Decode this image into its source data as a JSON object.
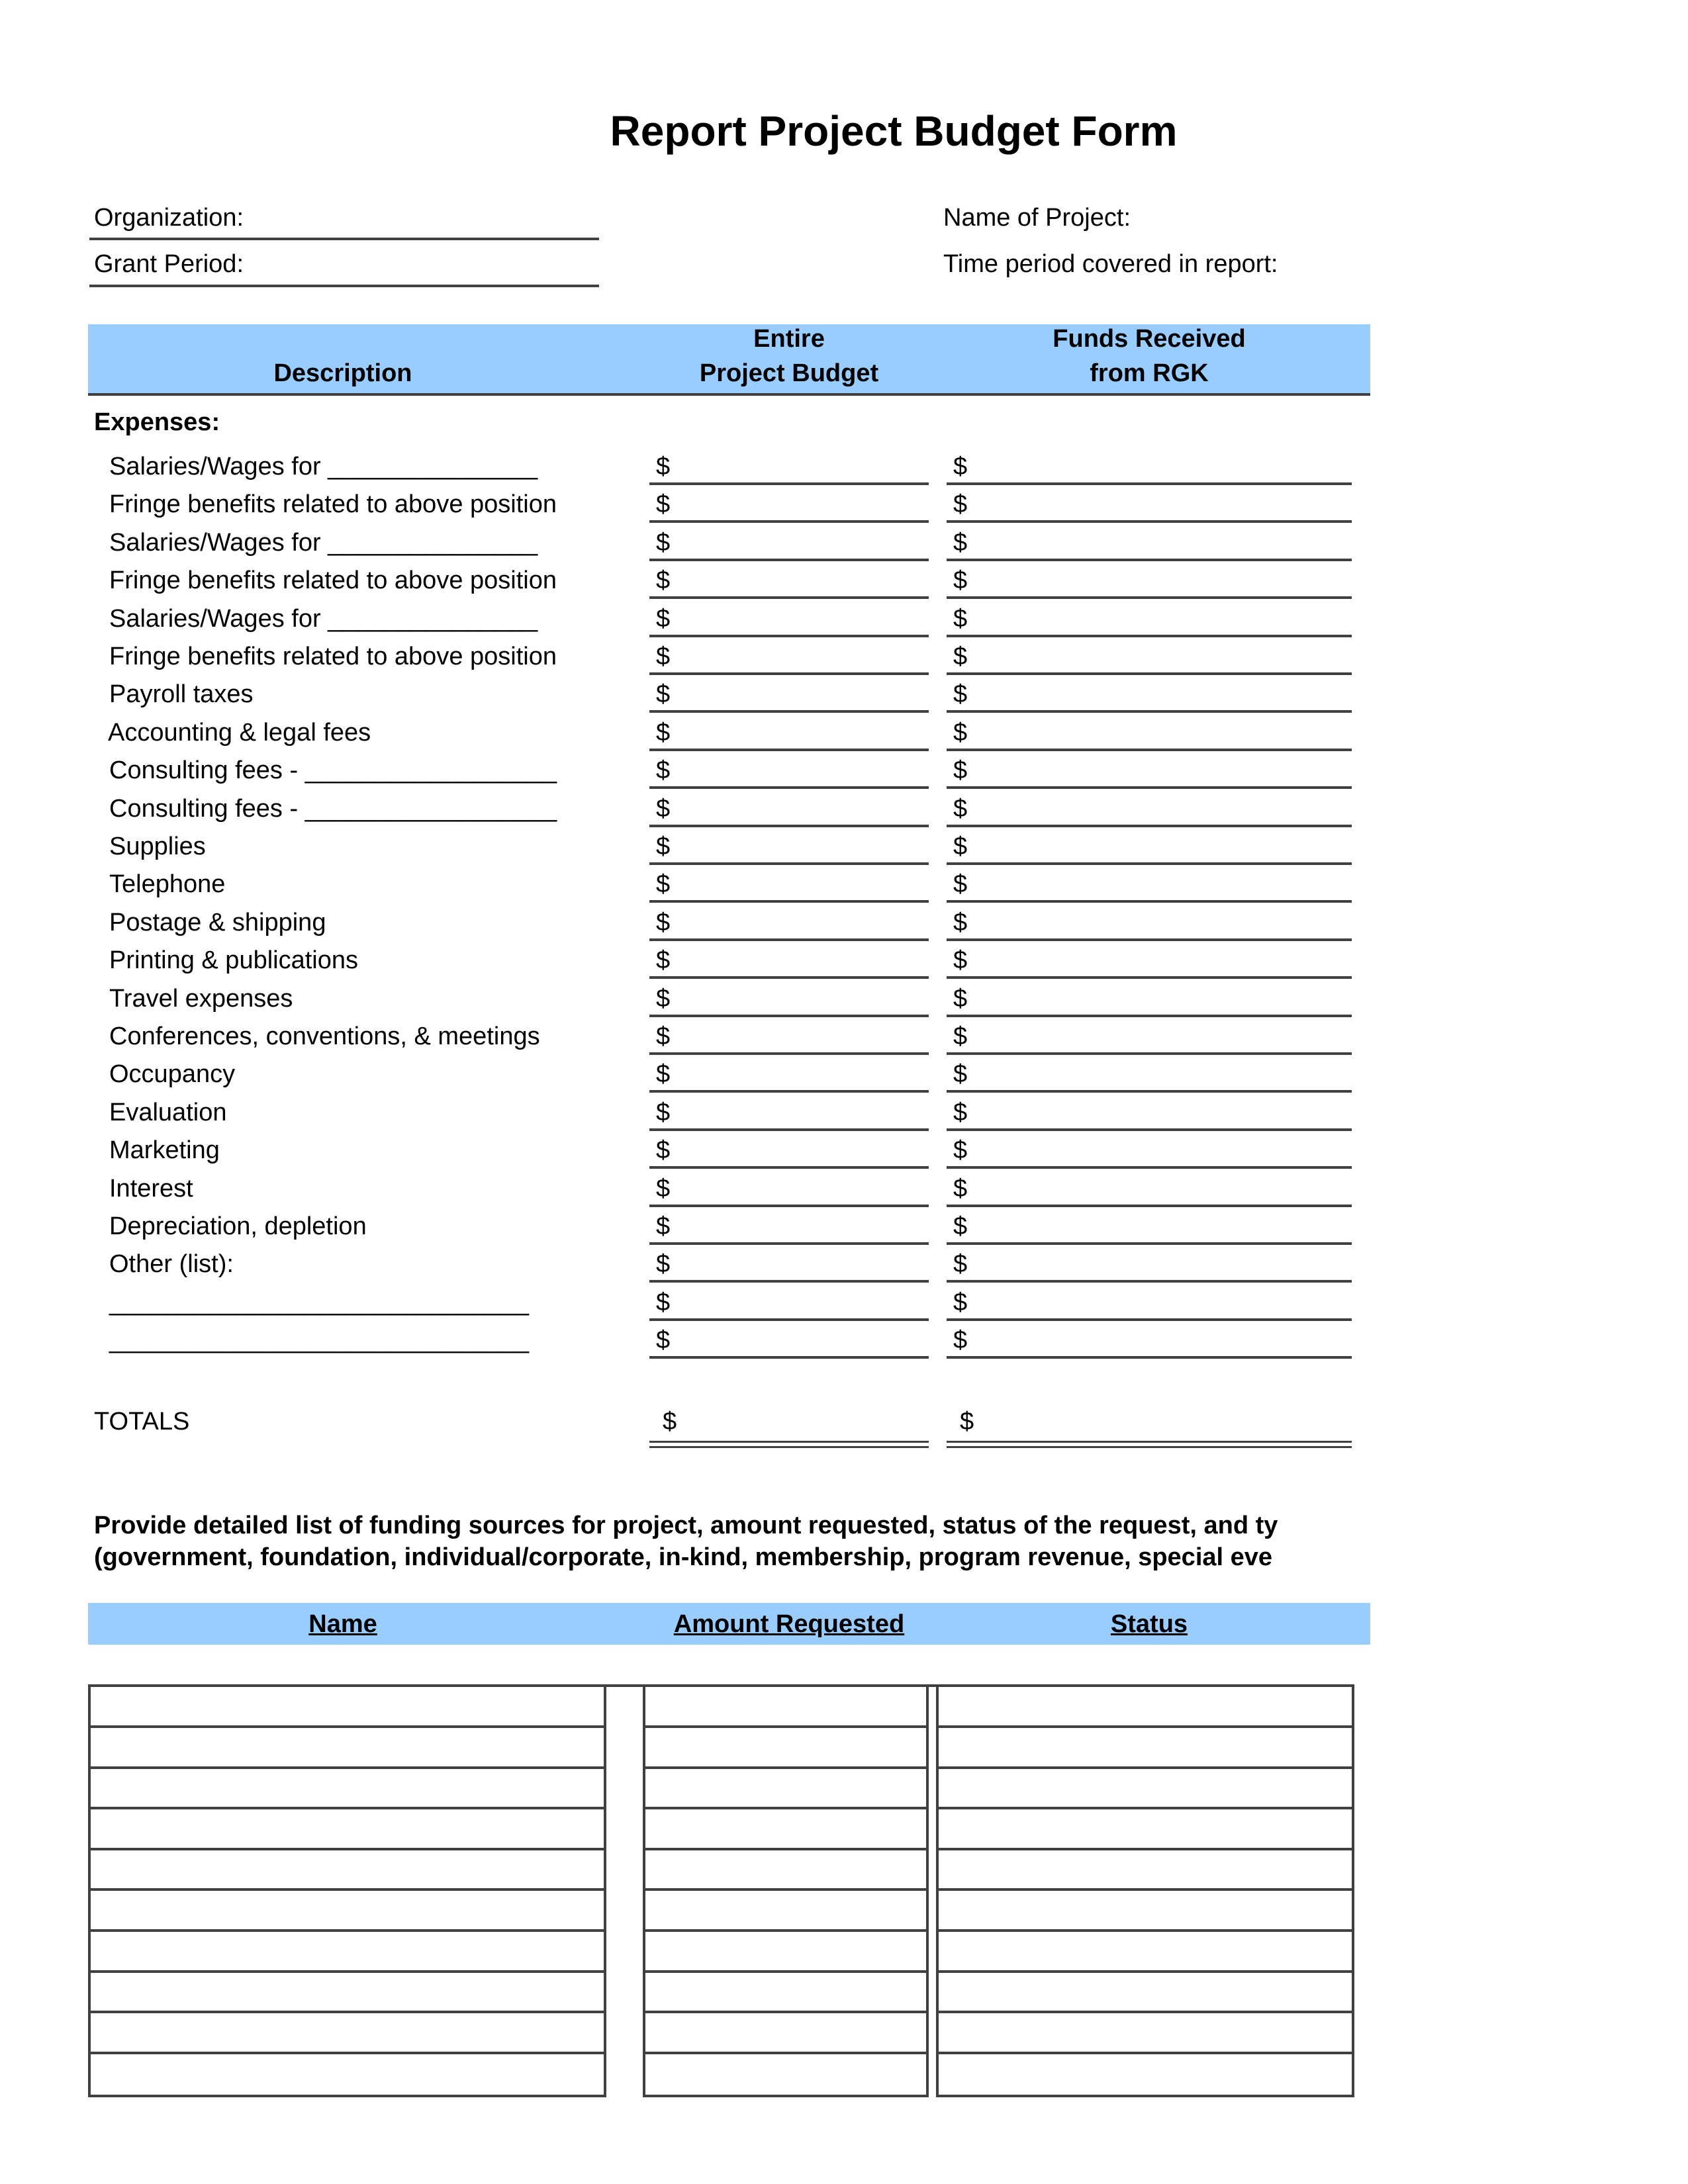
{
  "title": "Report Project Budget Form",
  "header_fields": {
    "organization_label": "Organization:",
    "grant_period_label": "Grant Period:",
    "project_name_label": "Name of Project:",
    "time_period_label": "Time period covered in report:"
  },
  "budget_table": {
    "columns": {
      "description": "Description",
      "entire_budget_line1": "Entire",
      "entire_budget_line2": "Project Budget",
      "funds_received_line1": "Funds Received",
      "funds_received_line2": "from RGK"
    },
    "section_label": "Expenses:",
    "currency_symbol": "$",
    "rows": [
      {
        "label": "Salaries/Wages for _______________"
      },
      {
        "label": "Fringe benefits related to above position"
      },
      {
        "label": "Salaries/Wages for _______________"
      },
      {
        "label": "Fringe benefits related to above position"
      },
      {
        "label": "Salaries/Wages for _______________"
      },
      {
        "label": "Fringe benefits related to above position"
      },
      {
        "label": "Payroll taxes"
      },
      {
        "label": "Accounting & legal fees"
      },
      {
        "label": "Consulting fees - __________________"
      },
      {
        "label": "Consulting fees - __________________"
      },
      {
        "label": "Supplies"
      },
      {
        "label": "Telephone"
      },
      {
        "label": "Postage & shipping"
      },
      {
        "label": "Printing & publications"
      },
      {
        "label": "Travel expenses"
      },
      {
        "label": "Conferences, conventions, & meetings"
      },
      {
        "label": "Occupancy"
      },
      {
        "label": "Evaluation"
      },
      {
        "label": "Marketing"
      },
      {
        "label": "Interest"
      },
      {
        "label": "Depreciation, depletion"
      },
      {
        "label": "Other (list):"
      },
      {
        "label": "______________________________"
      },
      {
        "label": "______________________________"
      }
    ],
    "totals_label": "TOTALS"
  },
  "funding_sources": {
    "instructions_line1": "Provide detailed list of funding sources for project, amount requested, status of the request, and ty",
    "instructions_line2": "(government, foundation, individual/corporate, in-kind, membership, program revenue, special eve",
    "columns": {
      "name": "Name",
      "amount": "Amount Requested",
      "status": "Status"
    },
    "row_count": 10
  },
  "colors": {
    "header_band": "#99ccff",
    "rule": "#404040"
  }
}
